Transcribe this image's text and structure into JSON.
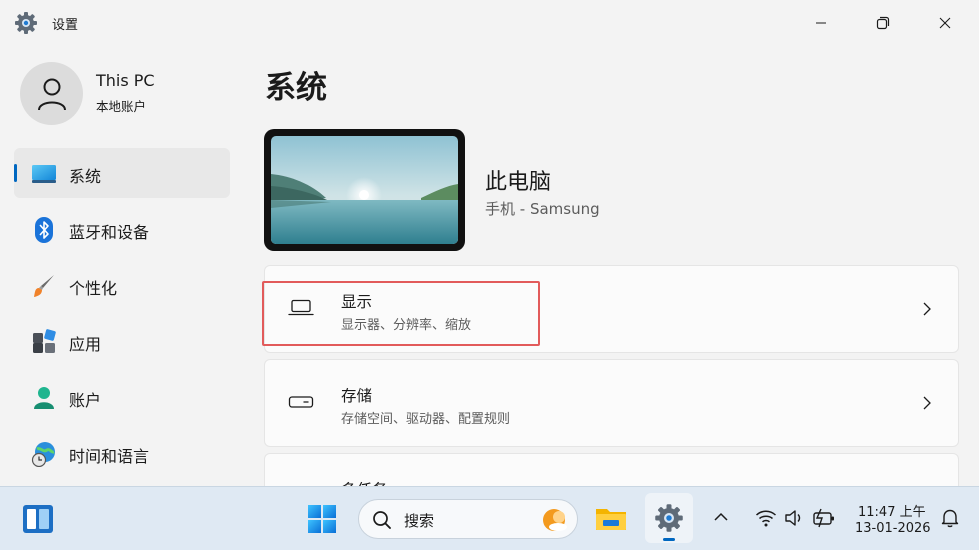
{
  "window": {
    "title": "设置",
    "controls": {
      "minimize_icon": "minimize-icon",
      "maximize_icon": "restore-icon",
      "close_icon": "close-icon"
    }
  },
  "account": {
    "name": "This PC",
    "type": "本地账户"
  },
  "sidebar": {
    "items": [
      {
        "label": "系统",
        "icon": "system-icon",
        "active": true
      },
      {
        "label": "蓝牙和设备",
        "icon": "bluetooth-icon"
      },
      {
        "label": "个性化",
        "icon": "brush-icon"
      },
      {
        "label": "应用",
        "icon": "apps-icon"
      },
      {
        "label": "账户",
        "icon": "person-icon"
      },
      {
        "label": "时间和语言",
        "icon": "globe-clock-icon"
      }
    ]
  },
  "main": {
    "title": "系统",
    "device": {
      "name": "此电脑",
      "model": "手机 - Samsung"
    },
    "cards": [
      {
        "title": "显示",
        "subtitle": "显示器、分辨率、缩放",
        "icon": "laptop-icon"
      },
      {
        "title": "存储",
        "subtitle": "存储空间、驱动器、配置规则",
        "icon": "storage-icon"
      },
      {
        "title": "多任务",
        "subtitle": "",
        "icon": "multitask-icon"
      }
    ]
  },
  "taskbar": {
    "search_label": "搜索",
    "time": "11:47 上午",
    "date": "13-01-2026"
  },
  "colors": {
    "accent": "#0067c0",
    "highlight": "#e25b5b"
  }
}
